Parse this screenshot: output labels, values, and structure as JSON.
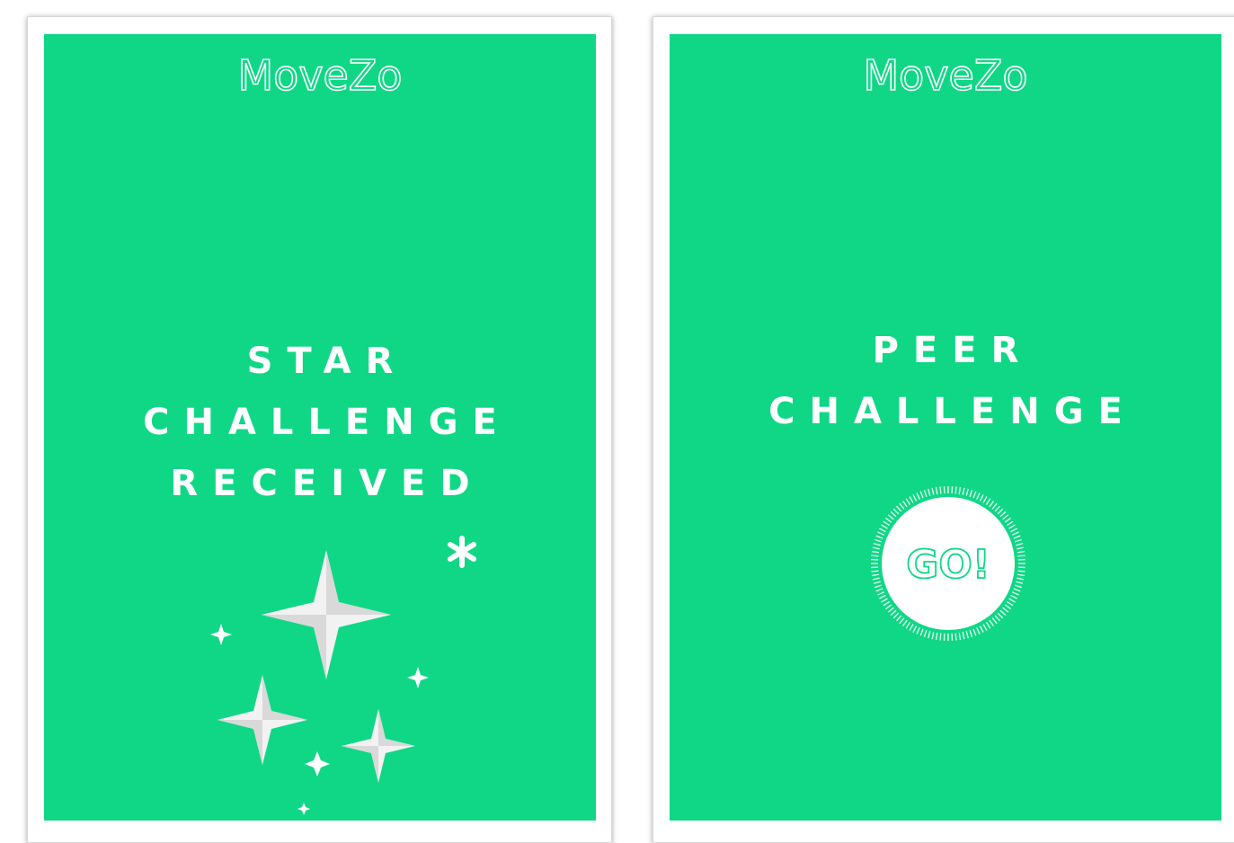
{
  "colors": {
    "brand_green": "#10d786",
    "white": "#ffffff",
    "star_grey": "#e6e6e6"
  },
  "screens": [
    {
      "logo_text": "MoveZo",
      "headline_lines": [
        "STAR",
        "CHALLENGE",
        "RECEIVED"
      ],
      "illustration": "sparkle-stars-icon"
    },
    {
      "logo_text": "MoveZo",
      "headline_lines": [
        "PEER",
        "CHALLENGE"
      ],
      "button_label": "GO!"
    }
  ]
}
